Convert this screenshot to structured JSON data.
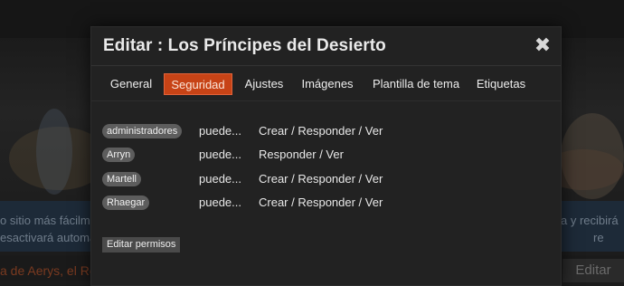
{
  "background": {
    "notice_line1": "o sitio más fácilm",
    "notice_line2": "esactivará automá",
    "notice_right1": "a y recibirá",
    "notice_right2": "re",
    "footer_text": "a de Aerys, el Rey",
    "edit_button": "Editar"
  },
  "modal": {
    "title": "Editar : Los Príncipes del Desierto",
    "close_glyph": "✖",
    "tabs": [
      {
        "label": "General",
        "active": false
      },
      {
        "label": "Seguridad",
        "active": true
      },
      {
        "label": "Ajustes",
        "active": false
      },
      {
        "label": "Imágenes",
        "active": false
      },
      {
        "label": "Plantilla de tema",
        "active": false
      },
      {
        "label": "Etiquetas",
        "active": false
      }
    ],
    "permissions": [
      {
        "group": "administradores",
        "can": "puede...",
        "perms": "Crear / Responder / Ver"
      },
      {
        "group": "Arryn",
        "can": "puede...",
        "perms": "Responder / Ver"
      },
      {
        "group": "Martell",
        "can": "puede...",
        "perms": "Crear / Responder / Ver"
      },
      {
        "group": "Rhaegar",
        "can": "puede...",
        "perms": "Crear / Responder / Ver"
      }
    ],
    "edit_permissions_button": "Editar permisos"
  },
  "colors": {
    "accent": "#c74316",
    "modal_bg": "#222222",
    "badge_bg": "#5d5d5d"
  }
}
